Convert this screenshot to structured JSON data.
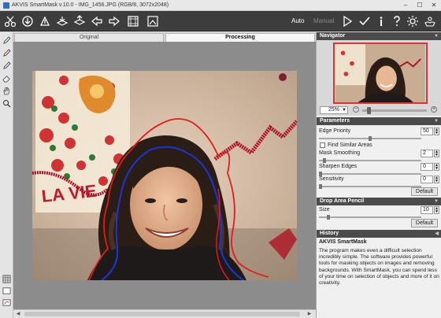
{
  "window": {
    "title": "AKVIS SmartMask v.10.0 - IMG_1456.JPG (RGB/8, 3072x2048)",
    "buttons": [
      "–",
      "☐",
      "✕"
    ]
  },
  "toolbar": {
    "mode_auto": "Auto",
    "mode_manual": "Manual"
  },
  "tabs": {
    "original": "Original",
    "processing": "Processing"
  },
  "navigator": {
    "title": "Navigator",
    "zoom": "25%"
  },
  "parameters": {
    "title": "Parameters",
    "edge_priority": {
      "label": "Edge Priority",
      "value": "50",
      "level": 0.5
    },
    "find_similar": {
      "label": "Find Similar Areas",
      "checked": false
    },
    "mask_smoothing": {
      "label": "Mask Smoothing",
      "value": "2",
      "level": 0.05
    },
    "sharpen_edges": {
      "label": "Sharpen Edges",
      "value": "0",
      "level": 0
    },
    "sensitivity": {
      "label": "Sensitivity",
      "value": "0",
      "level": 0
    },
    "default_label": "Default"
  },
  "drop_area": {
    "title": "Drop Area Pencil",
    "size": {
      "label": "Size",
      "value": "10",
      "level": 0.08
    },
    "default_label": "Default"
  },
  "history": {
    "title": "History",
    "heading": "AKVIS SmartMask",
    "text": "The program makes even a difficult selection incredibly simple. The software provides powerful tools for masking objects on images and removing backgrounds. With SmartMask, you can spend less of your time on selection of objects and more of it on creativity."
  },
  "photo_text": "LA VIE"
}
